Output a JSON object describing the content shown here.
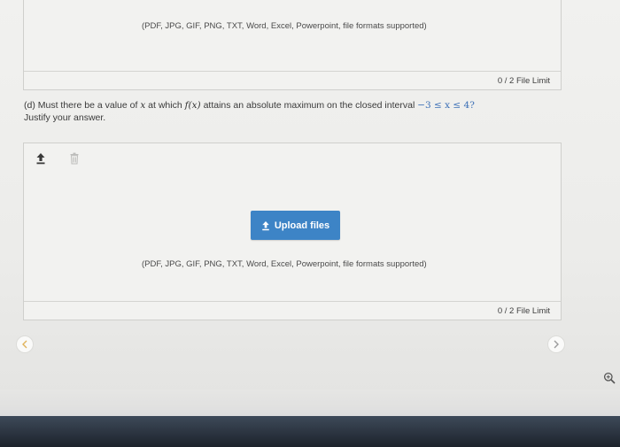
{
  "panel_top": {
    "formats_note": "(PDF, JPG, GIF, PNG, TXT, Word, Excel, Powerpoint, file formats supported)",
    "file_limit": "0 / 2 File Limit"
  },
  "question": {
    "part": "(d) Must there be a value of",
    "var": "x",
    "mid1": "at which",
    "func": "f(x)",
    "mid2": "attains an absolute maximum on the closed interval",
    "interval": "−3 ≤ x ≤ 4?",
    "line2": "Justify your answer."
  },
  "panel_bottom": {
    "upload_label": "Upload files",
    "formats_note": "(PDF, JPG, GIF, PNG, TXT, Word, Excel, Powerpoint, file formats supported)",
    "file_limit": "0 / 2 File Limit"
  },
  "icons": {
    "toolbar_upload": "upload-icon",
    "toolbar_trash": "trash-icon",
    "button_upload": "upload-icon",
    "prev": "chevron-left-icon",
    "next": "chevron-right-icon",
    "zoom": "zoom-in-icon"
  },
  "colors": {
    "upload_button": "#3d84c6",
    "interval_math": "#3b6fb6",
    "nav_prev_chevron": "#e0b25a",
    "nav_next_chevron": "#9a9a9a"
  }
}
